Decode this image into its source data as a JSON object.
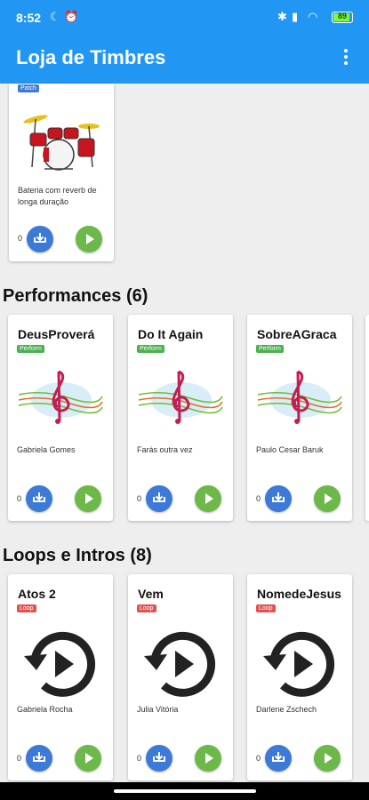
{
  "status": {
    "time": "8:52",
    "battery": "89"
  },
  "appbar": {
    "title": "Loja de Timbres"
  },
  "top_card": {
    "badge": "Patch",
    "desc": "Bateria com reverb de longa duração",
    "count": "0"
  },
  "sections": [
    {
      "title": "Performances (6)",
      "badge": "Perform",
      "art": "music-clef-icon",
      "cards": [
        {
          "name": "DeusProverá",
          "desc": "Gabriela Gomes",
          "count": "0"
        },
        {
          "name": "Do It Again",
          "desc": "Farás outra vez",
          "count": "0"
        },
        {
          "name": "SobreAGraca",
          "desc": "Paulo Cesar Baruk",
          "count": "0"
        }
      ]
    },
    {
      "title": "Loops e Intros (8)",
      "badge": "Loop",
      "art": "replay-play-icon",
      "cards": [
        {
          "name": "Atos 2",
          "desc": "Gabriela Rocha",
          "count": "0"
        },
        {
          "name": "Vem",
          "desc": "Julia Vitória",
          "count": "0"
        },
        {
          "name": "NomedeJesus",
          "desc": "Darlene Zschech",
          "count": "0"
        }
      ]
    }
  ],
  "colors": {
    "primary": "#2196f3",
    "download": "#3d7ad8",
    "play": "#6cb848",
    "perform_badge": "#4caf50",
    "loop_badge": "#e05353"
  }
}
